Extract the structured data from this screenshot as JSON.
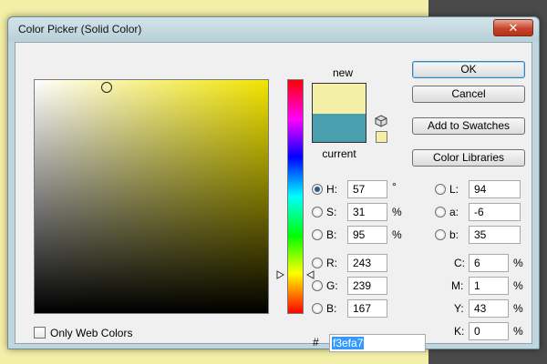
{
  "dialog": {
    "title": "Color Picker (Solid Color)",
    "close_glyph": "✕"
  },
  "preview": {
    "new_label": "new",
    "current_label": "current",
    "new_color": "#f3efa7",
    "current_color": "#4a9fae"
  },
  "buttons": {
    "ok": "OK",
    "cancel": "Cancel",
    "add_to_swatches": "Add to Swatches",
    "color_libraries": "Color Libraries"
  },
  "hsb": {
    "h": {
      "label": "H:",
      "value": "57",
      "unit": "°"
    },
    "s": {
      "label": "S:",
      "value": "31",
      "unit": "%"
    },
    "b": {
      "label": "B:",
      "value": "95",
      "unit": "%"
    }
  },
  "rgb": {
    "r": {
      "label": "R:",
      "value": "243"
    },
    "g": {
      "label": "G:",
      "value": "239"
    },
    "b": {
      "label": "B:",
      "value": "167"
    }
  },
  "lab": {
    "l": {
      "label": "L:",
      "value": "94"
    },
    "a": {
      "label": "a:",
      "value": "-6"
    },
    "b": {
      "label": "b:",
      "value": "35"
    }
  },
  "cmyk": {
    "c": {
      "label": "C:",
      "value": "6",
      "unit": "%"
    },
    "m": {
      "label": "M:",
      "value": "1",
      "unit": "%"
    },
    "y": {
      "label": "Y:",
      "value": "43",
      "unit": "%"
    },
    "k": {
      "label": "K:",
      "value": "0",
      "unit": "%"
    }
  },
  "hex": {
    "label": "#",
    "value": "f3efa7"
  },
  "web_colors": {
    "label": "Only Web Colors",
    "checked": false
  },
  "colors": {
    "field_hue": "#f2e400",
    "accent": "#3399ff"
  }
}
